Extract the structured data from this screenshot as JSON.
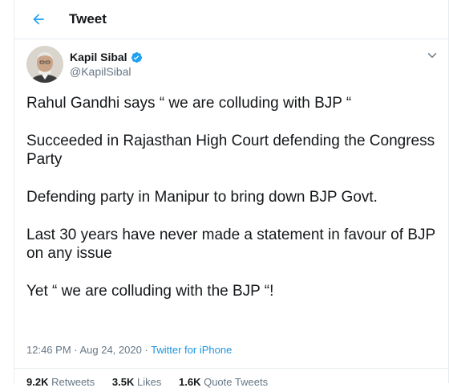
{
  "header": {
    "title": "Tweet",
    "back_icon": "back-arrow-icon",
    "accent_color": "#1da1f2"
  },
  "author": {
    "name": "Kapil Sibal",
    "handle": "@KapilSibal",
    "verified_icon": "verified-badge-icon",
    "avatar_icon": "profile-photo"
  },
  "tweet": {
    "paragraphs": [
      "Rahul Gandhi says “ we are colluding with BJP “",
      "Succeeded in Rajasthan High Court defending the Congress Party",
      "Defending party in Manipur to bring down BJP Govt.",
      "Last 30 years have never made a statement in favour of BJP on any issue",
      "Yet “ we are colluding with the BJP “!"
    ],
    "timestamp": "12:46 PM · Aug 24, 2020",
    "separator": " · ",
    "source": "Twitter for iPhone"
  },
  "stats": {
    "retweets_count": "9.2K",
    "retweets_label": "Retweets",
    "likes_count": "3.5K",
    "likes_label": "Likes",
    "quote_count": "1.6K",
    "quote_label": "Quote Tweets"
  },
  "colors": {
    "text": "#14171a",
    "secondary": "#657786",
    "link": "#1b95e0",
    "border": "#e6ecf0"
  }
}
